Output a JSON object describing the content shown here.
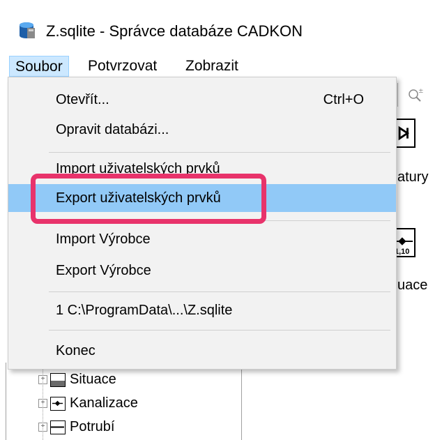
{
  "window": {
    "title": "Z.sqlite - Správce databáze CADKON",
    "icon": "database-icon"
  },
  "menubar": {
    "items": [
      {
        "label": "Soubor",
        "state": "open"
      },
      {
        "label": "Potvrzovat"
      },
      {
        "label": "Zobrazit"
      }
    ]
  },
  "file_menu": {
    "items": [
      {
        "label": "Otevřít...",
        "shortcut": "Ctrl+O"
      },
      {
        "label": "Opravit databázi..."
      },
      {
        "label": "Import uživatelských prvků"
      },
      {
        "label": "Export uživatelských prvků",
        "state": "highlighted"
      },
      {
        "label": "Import Výrobce"
      },
      {
        "label": "Export Výrobce"
      },
      {
        "label": "1 C:\\ProgramData\\...\\Z.sqlite"
      },
      {
        "label": "Konec"
      }
    ],
    "highlight_color": "#91c9f7",
    "callout_color": "#e8336b"
  },
  "background": {
    "right_labels": [
      "atury",
      "uace"
    ],
    "button_caption": "1,10",
    "tree": [
      {
        "label": "Situace",
        "icon": "situation-icon"
      },
      {
        "label": "Kanalizace",
        "icon": "sewer-valve-icon"
      },
      {
        "label": "Potrubí",
        "icon": "pipe-icon"
      }
    ]
  }
}
